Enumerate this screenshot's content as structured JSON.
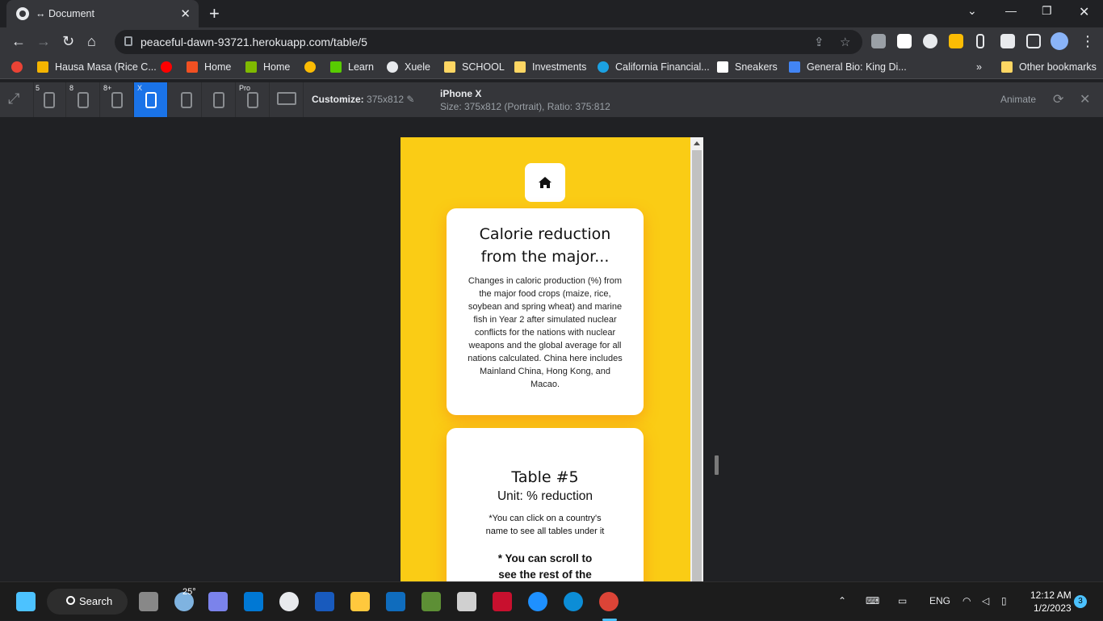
{
  "browser": {
    "tab_title": "↔ Document",
    "url": "peaceful-dawn-93721.herokuapp.com/table/5"
  },
  "bookmarks": [
    {
      "label": "Hausa Masa (Rice C...",
      "color": "#f4b400"
    },
    {
      "label": "",
      "color": "#ff0000"
    },
    {
      "label": "Home",
      "color": "#f25022"
    },
    {
      "label": "Home",
      "color": "#7fba00"
    },
    {
      "label": "",
      "color": "#fbbc04"
    },
    {
      "label": "Learn",
      "color": "#58cc02"
    },
    {
      "label": "Xuele",
      "color": "#e8eaed"
    },
    {
      "label": "SCHOOL",
      "color": "#fdd663"
    },
    {
      "label": "Investments",
      "color": "#fdd663"
    },
    {
      "label": "California Financial...",
      "color": "#1ba1e2"
    },
    {
      "label": "Sneakers",
      "color": "#ffffff"
    },
    {
      "label": "General Bio: King Di...",
      "color": "#4285f4"
    }
  ],
  "bookmarks_more": "»",
  "other_bookmarks": "Other bookmarks",
  "device_bar": {
    "devices": [
      "5",
      "8",
      "8+",
      "X",
      "",
      "",
      "Pro",
      ""
    ],
    "customize_label": "Customize:",
    "customize_value": "375x812",
    "device_name": "iPhone X",
    "device_size": "Size: 375x812 (Portrait), Ratio: 375:812",
    "animate_label": "Animate"
  },
  "page": {
    "card1_title": "Calorie reduction from the major...",
    "card1_text": "Changes in caloric production (%) from the major food crops (maize, rice, soybean and spring wheat) and marine fish in Year 2 after simulated nuclear conflicts for the nations with nuclear weapons and the global average for all nations calculated. China here includes Mainland China, Hong Kong, and Macao.",
    "table_title": "Table #5",
    "unit": "Unit: % reduction",
    "note": "*You can click on a country's name to see all tables under it",
    "scroll_note": "* You can scroll to see the rest of the"
  },
  "taskbar": {
    "search_label": "Search",
    "weather": "25°",
    "lang": "ENG",
    "time": "12:12 AM",
    "date": "1/2/2023",
    "notifications": "3"
  }
}
